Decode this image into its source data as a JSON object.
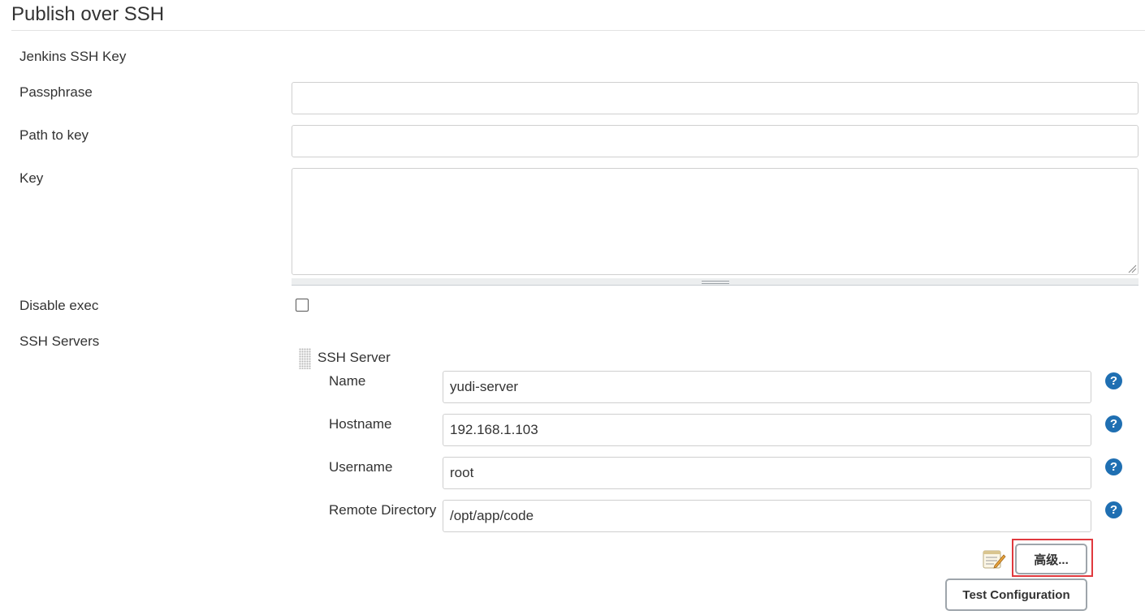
{
  "section": {
    "title": "Publish over SSH"
  },
  "ssh_key": {
    "jenkins_ssh_key_label": "Jenkins SSH Key",
    "passphrase_label": "Passphrase",
    "passphrase_value": "",
    "path_to_key_label": "Path to key",
    "path_to_key_value": "",
    "key_label": "Key",
    "key_value": "",
    "disable_exec_label": "Disable exec",
    "disable_exec_checked": false
  },
  "ssh_servers": {
    "label": "SSH Servers",
    "server": {
      "title": "SSH Server",
      "name_label": "Name",
      "name_value": "yudi-server",
      "hostname_label": "Hostname",
      "hostname_value": "192.168.1.103",
      "username_label": "Username",
      "username_value": "root",
      "remote_directory_label": "Remote Directory",
      "remote_directory_value": "/opt/app/code",
      "help_glyph": "?",
      "advanced_button_label": "高级...",
      "test_button_label": "Test Configuration"
    }
  },
  "colors": {
    "help_icon": "#1f6fb2",
    "highlight_border": "#e0393e",
    "button_border": "#9ea5ab"
  },
  "icons": {
    "help": "help-circle-icon",
    "notepad": "notepad-edit-icon",
    "drag": "drag-handle-icon"
  }
}
